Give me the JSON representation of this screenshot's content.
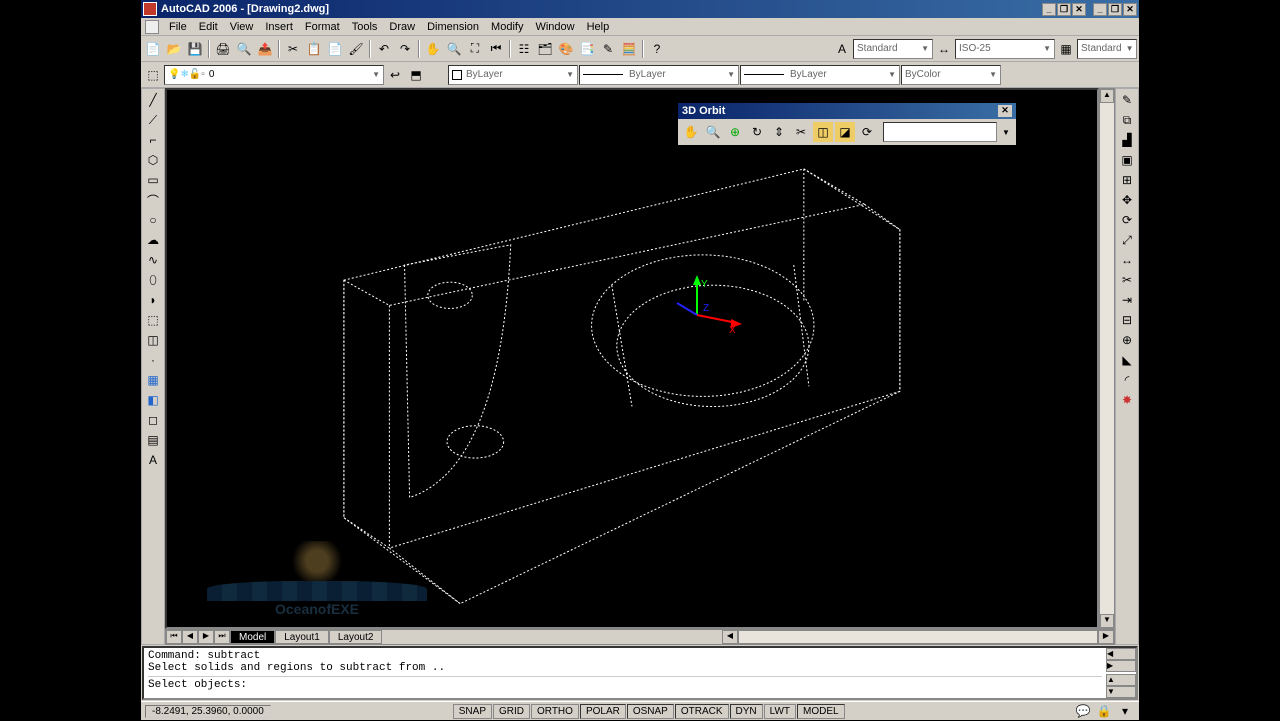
{
  "title": "AutoCAD 2006 - [Drawing2.dwg]",
  "menus": [
    "File",
    "Edit",
    "View",
    "Insert",
    "Format",
    "Tools",
    "Draw",
    "Dimension",
    "Modify",
    "Window",
    "Help"
  ],
  "toolbar1_dropdowns": {
    "textStyle": "Standard",
    "dimStyle": "ISO-25",
    "tableStyle": "Standard"
  },
  "layer_dropdown": "0",
  "props": {
    "layer": "ByLayer",
    "ltype": "ByLayer",
    "lweight": "ByLayer",
    "color": "ByColor"
  },
  "orbit": {
    "title": "3D Orbit"
  },
  "tabs": [
    "Model",
    "Layout1",
    "Layout2"
  ],
  "command": {
    "line1": "Command: subtract",
    "line2": "Select solids and regions to subtract from ..",
    "line3": "Select objects:"
  },
  "status": {
    "coords": "-8.2491, 25.3960, 0.0000",
    "buttons": [
      "SNAP",
      "GRID",
      "ORTHO",
      "POLAR",
      "OSNAP",
      "OTRACK",
      "DYN",
      "LWT",
      "MODEL"
    ]
  },
  "watermark": "OceanofEXE"
}
